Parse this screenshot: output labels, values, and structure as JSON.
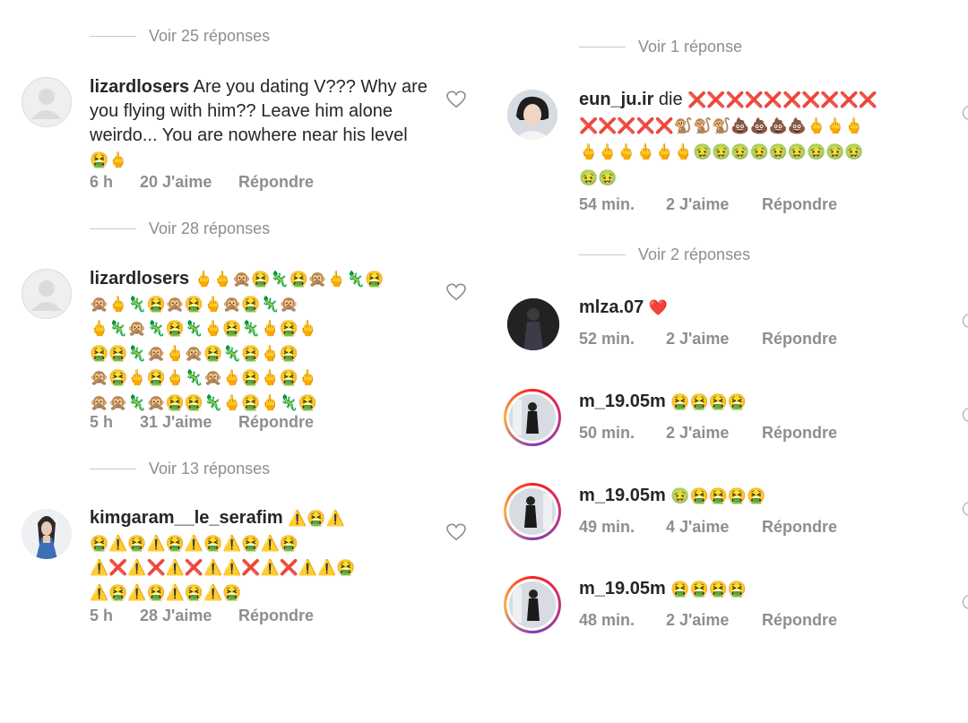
{
  "left": {
    "top_view_more": "Voir 25 réponses",
    "comments": [
      {
        "username": "lizardlosers",
        "text": "Are you dating V??? Why are you flying with him?? Leave him alone weirdo... You are nowhere near his level",
        "emoji_line": "🤮🖕",
        "time": "6 h",
        "likes": "20 J'aime",
        "reply": "Répondre",
        "view_more": "Voir 28 réponses"
      },
      {
        "username": "lizardlosers",
        "emoji_lines": [
          "🖕🖕🙊🤮🦎🤮🙊🖕🦎🤮",
          "🙊🖕🦎🤮🙊🤮🖕🙊🤮🦎🙊",
          "🖕🦎🙊🦎🤮🦎🖕🤮🦎🖕🤮🖕",
          "🤮🤮🦎🙊🖕🙊🤮🦎🤮🖕🤮",
          "🙊🤮🖕🤮🖕🦎🙊🖕🤮🖕🤮🖕",
          "🙊🙊🦎🙊🤮🤮🦎🖕🤮🖕🦎🤮"
        ],
        "time": "5 h",
        "likes": "31 J'aime",
        "reply": "Répondre",
        "view_more": "Voir 13 réponses"
      },
      {
        "username": "kimgaram__le_serafim",
        "emoji_first": "⚠️🤮⚠️",
        "emoji_lines": [
          "🤮⚠️🤮⚠️🤮⚠️🤮⚠️🤮⚠️🤮",
          "⚠️❌⚠️❌⚠️❌⚠️⚠️❌⚠️❌⚠️⚠️🤮",
          "⚠️🤮⚠️🤮⚠️🤮⚠️🤮"
        ],
        "time": "5 h",
        "likes": "28 J'aime",
        "reply": "Répondre"
      }
    ]
  },
  "right": {
    "top_view_more": "Voir 1 réponse",
    "comments": [
      {
        "username": "eun_ju.ir",
        "text": "die",
        "emoji_first": "❌❌❌❌❌❌❌❌❌❌",
        "emoji_lines": [
          "❌❌❌❌❌🐒🐒🐒💩💩💩💩🖕🖕🖕",
          "🖕🖕🖕🖕🖕🖕🤢🤢🤢🤢🤢🤢🤢🤢🤢",
          "🤢🤢"
        ],
        "time": "54 min.",
        "likes": "2 J'aime",
        "reply": "Répondre",
        "view_more": "Voir 2 réponses"
      },
      {
        "username": "mlza.07",
        "emoji": "❤️",
        "time": "52 min.",
        "likes": "2 J'aime",
        "reply": "Répondre"
      },
      {
        "username": "m_19.05m",
        "emoji": "🤮🤮🤮🤮",
        "time": "50 min.",
        "likes": "2 J'aime",
        "reply": "Répondre"
      },
      {
        "username": "m_19.05m",
        "emoji": "🤢🤮🤮🤮🤮",
        "time": "49 min.",
        "likes": "4 J'aime",
        "reply": "Répondre"
      },
      {
        "username": "m_19.05m",
        "emoji": "🤮🤮🤮🤮",
        "time": "48 min.",
        "likes": "2 J'aime",
        "reply": "Répondre"
      }
    ]
  }
}
